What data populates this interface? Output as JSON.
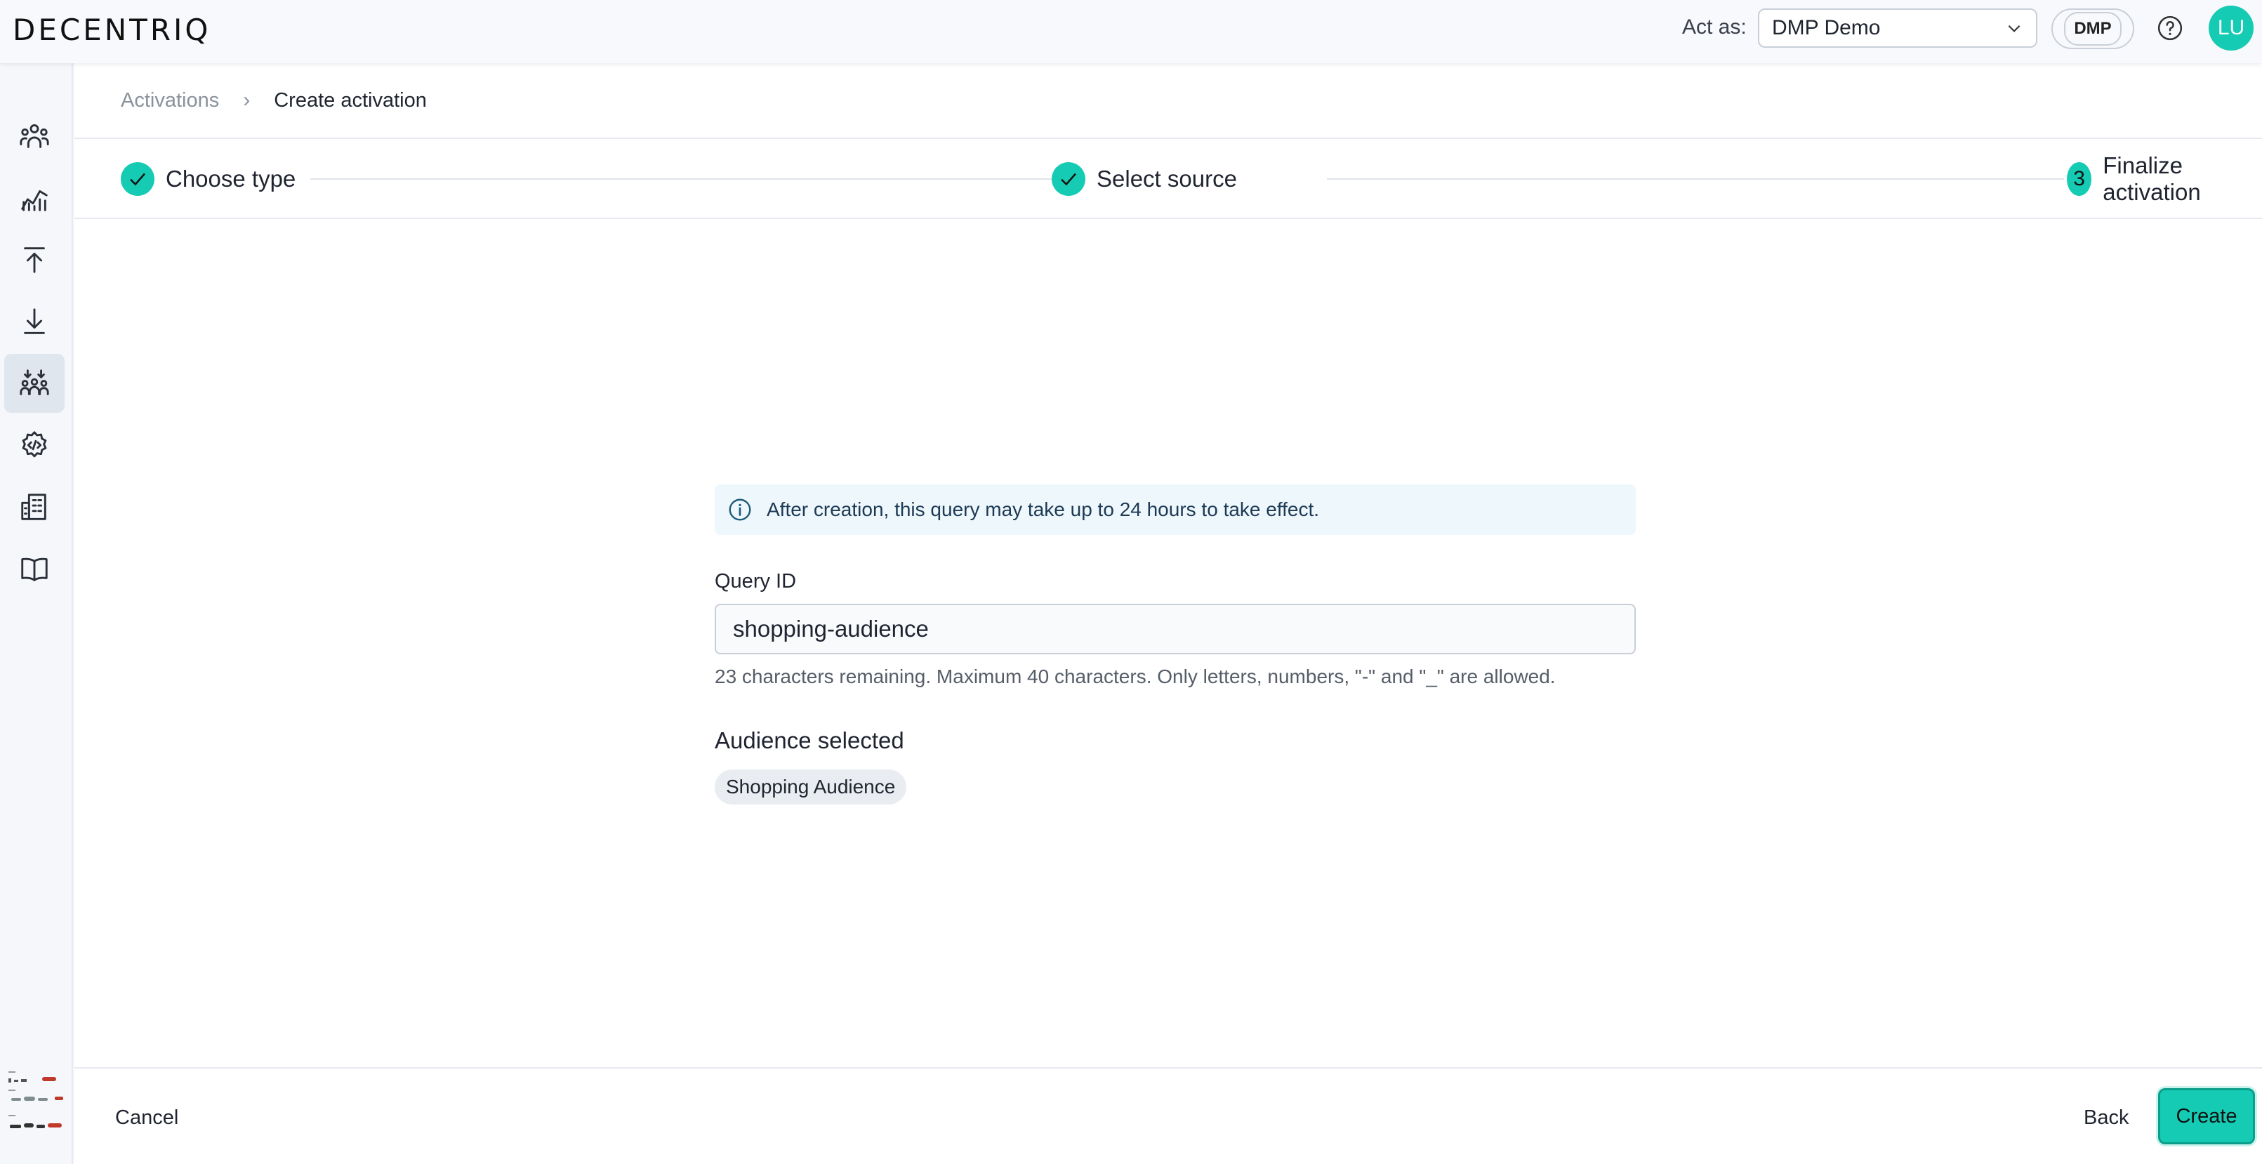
{
  "header": {
    "logo": "DECENTRIQ",
    "act_as_label": "Act as:",
    "act_as_value": "DMP Demo",
    "org_badge": "DMP",
    "avatar_initials": "LU",
    "accent_color": "#15cbb3"
  },
  "sidebar": {
    "items": [
      {
        "icon": "people-icon"
      },
      {
        "icon": "analytics-icon"
      },
      {
        "icon": "upload-icon"
      },
      {
        "icon": "download-icon"
      },
      {
        "icon": "audiences-icon",
        "active": true
      },
      {
        "icon": "settings-code-icon"
      },
      {
        "icon": "organization-icon"
      },
      {
        "icon": "docs-book-icon"
      }
    ],
    "expand_icon": "double-chevron-right-icon"
  },
  "breadcrumb": {
    "parent": "Activations",
    "current": "Create activation"
  },
  "stepper": {
    "steps": [
      {
        "label": "Choose type",
        "status": "done"
      },
      {
        "label": "Select source",
        "status": "done"
      },
      {
        "number": "3",
        "label": "Finalize activation",
        "status": "current"
      }
    ]
  },
  "form": {
    "info_text": "After creation, this query may take up to 24 hours to take effect.",
    "query_id_label": "Query ID",
    "query_id_value": "shopping-audience",
    "query_id_helper": "23 characters remaining. Maximum 40 characters. Only letters, numbers, \"-\" and \"_\" are allowed.",
    "audience_title": "Audience selected",
    "audience_chip": "Shopping Audience"
  },
  "footer": {
    "cancel_label": "Cancel",
    "back_label": "Back",
    "create_label": "Create"
  }
}
